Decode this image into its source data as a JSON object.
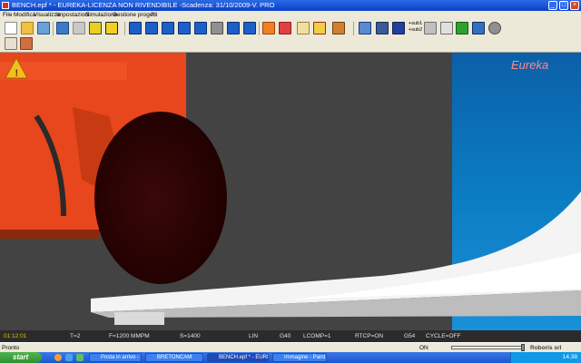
{
  "window": {
    "title": "BENCH.epf * - EUREKA-LICENZA NON RIVENDIBILE -Scadenza: 31/10/2009-V. PRO",
    "minimize": "_",
    "maximize": "□",
    "close": "×"
  },
  "menu": [
    "File",
    "Modifica",
    "Visualizza",
    "Impostazioni",
    "Simulazione",
    "Gestione progetti",
    "?"
  ],
  "toolbar": {
    "sub1_label": "+sub1",
    "sub2_label": "+sub2"
  },
  "viewport": {
    "logo": "Eureka",
    "warning_icon": "warning-triangle-icon"
  },
  "cnc_status": {
    "time": "01:12:01",
    "tool": "T=2",
    "feed": "F=1200 MMPM",
    "speed": "S=1400",
    "interp": "LIN",
    "g40": "G40",
    "lcomp": "LCOMP=1",
    "rtcp": "RTCP=ON",
    "g54": "G54",
    "cycle": "CYCLE=OFF"
  },
  "statusbar": {
    "left": "Pronto",
    "on": "ON",
    "company": "Roboris srl"
  },
  "taskbar": {
    "start": "start",
    "items": [
      "Posta in arrivo - Micro...",
      "BRETONCAM",
      "BENCH.epf * - EUREK...",
      "Immagine - Paint"
    ],
    "clock": "14.38"
  },
  "colors": {
    "accent_blue": "#2a6be6",
    "spindle_orange": "#e8461c",
    "background_blue": "#0b7cc2"
  }
}
